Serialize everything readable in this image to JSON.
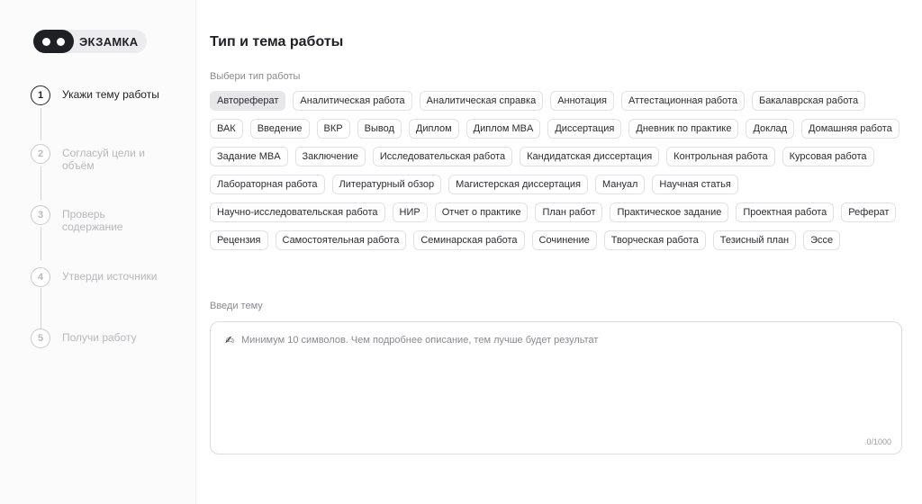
{
  "brand": {
    "name": "ЭКЗАМКА"
  },
  "steps": [
    {
      "number": "1",
      "label": "Укажи тему работы"
    },
    {
      "number": "2",
      "label": "Согласуй цели и объём"
    },
    {
      "number": "3",
      "label": "Проверь содержание"
    },
    {
      "number": "4",
      "label": "Утверди источники"
    },
    {
      "number": "5",
      "label": "Получи работу"
    }
  ],
  "main": {
    "title": "Тип и тема работы",
    "type_label": "Выбери тип работы",
    "selected_type": "Автореферат",
    "types": [
      "Автореферат",
      "Аналитическая работа",
      "Аналитическая справка",
      "Аннотация",
      "Аттестационная работа",
      "Бакалаврская работа",
      "ВАК",
      "Введение",
      "ВКР",
      "Вывод",
      "Диплом",
      "Диплом MBA",
      "Диссертация",
      "Дневник по практике",
      "Доклад",
      "Домашняя работа",
      "Задание MBA",
      "Заключение",
      "Исследовательская работа",
      "Кандидатская диссертация",
      "Контрольная работа",
      "Курсовая работа",
      "Лабораторная работа",
      "Литературный обзор",
      "Магистерская диссертация",
      "Мануал",
      "Научная статья",
      "Научно-исследовательская работа",
      "НИР",
      "Отчет о практике",
      "План работ",
      "Практическое задание",
      "Проектная работа",
      "Реферат",
      "Рецензия",
      "Самостоятельная работа",
      "Семинарская работа",
      "Сочинение",
      "Творческая работа",
      "Тезисный план",
      "Эссе"
    ],
    "topic_label": "Введи тему",
    "topic_placeholder": "Минимум 10 символов. Чем подробнее описание, тем лучше будет результат",
    "topic_value": "",
    "counter": "0/1000"
  },
  "icons": {
    "topic_hint": "writing-hand-icon"
  },
  "colors": {
    "accent": "#1f2024",
    "selected_chip": "#e7e7ea",
    "inactive": "#b7b7bc"
  }
}
